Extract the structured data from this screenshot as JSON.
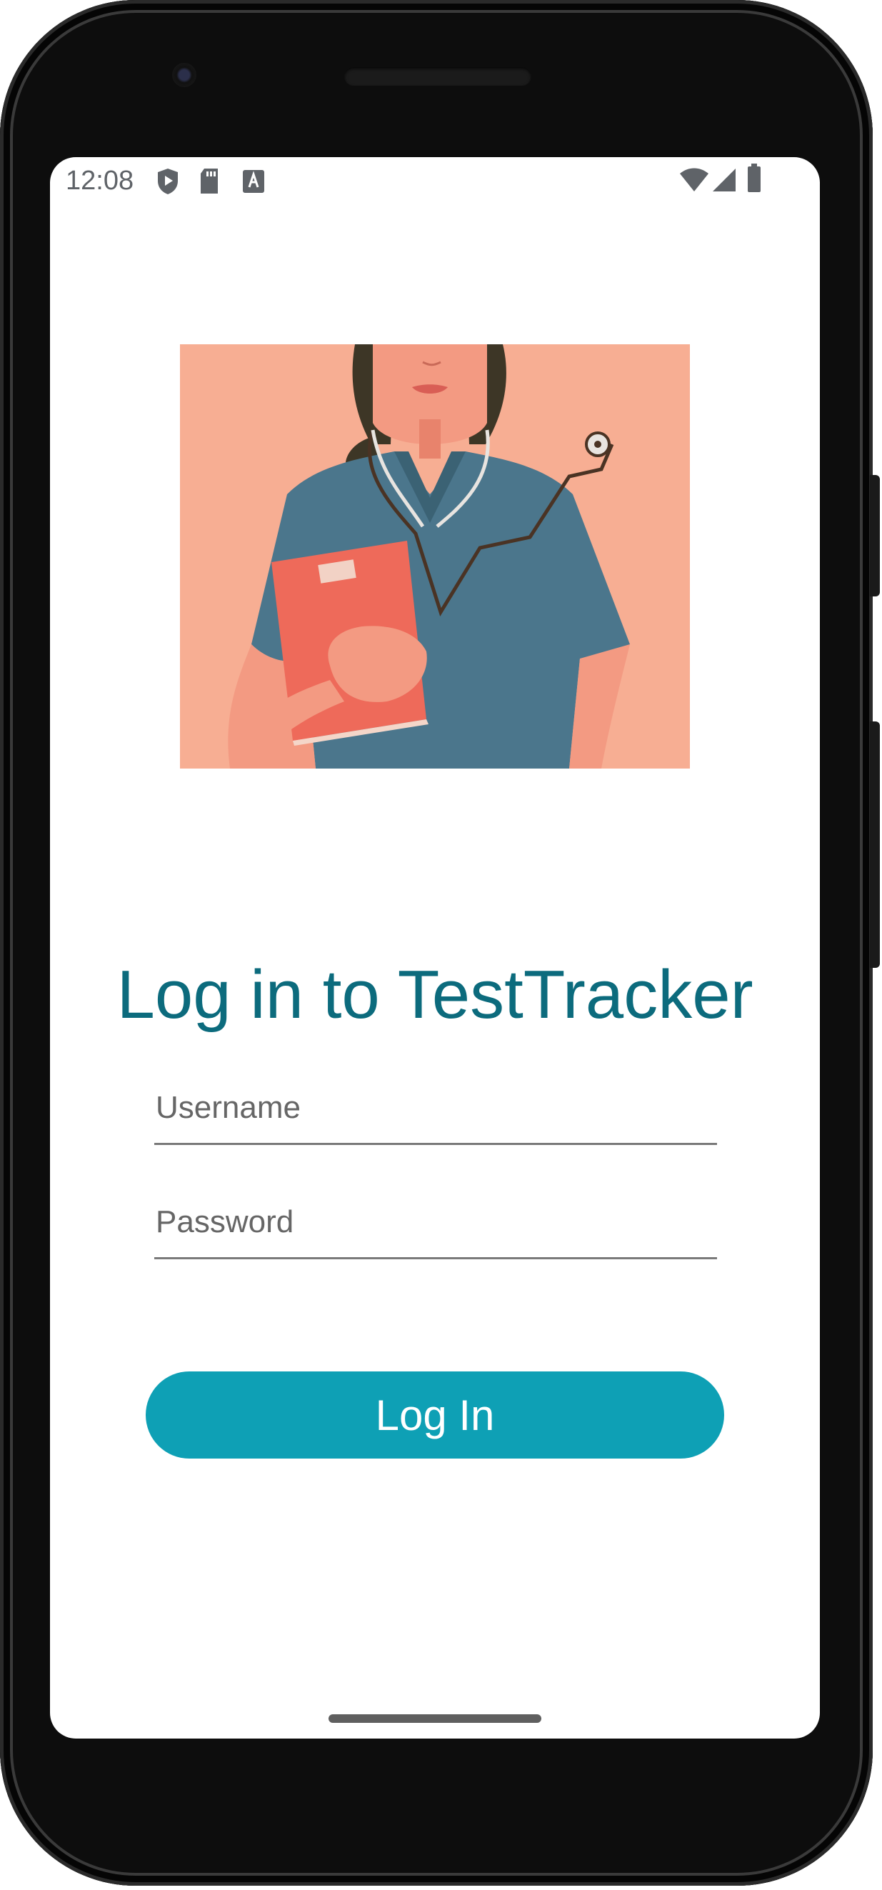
{
  "status_bar": {
    "time": "12:08",
    "left_icons": [
      "shield-play-icon",
      "sd-card-icon",
      "text-a-icon"
    ],
    "right_icons": [
      "wifi-icon",
      "cell-signal-icon",
      "battery-icon"
    ]
  },
  "hero_image": {
    "subject": "illustration-nurse-with-clipboard-and-stethoscope",
    "colors": {
      "background": "#f7ae93",
      "scrubs": "#4b768c",
      "clipboard": "#ee6a5a",
      "skin": "#f39a82"
    }
  },
  "login": {
    "title": "Log in to TestTracker",
    "username_placeholder": "Username",
    "password_placeholder": "Password",
    "button_label": "Log In"
  },
  "theme": {
    "title_color": "#0c6b7d",
    "button_color": "#0ea0b5"
  }
}
